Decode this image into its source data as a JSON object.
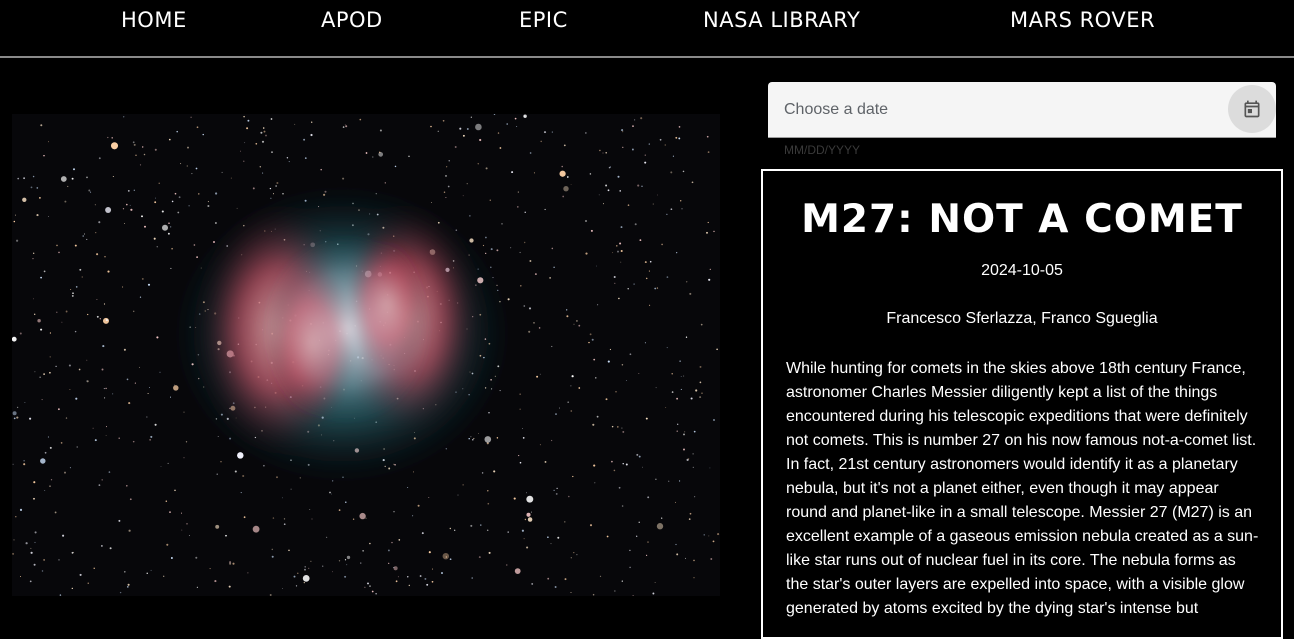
{
  "nav": {
    "items": [
      {
        "label": "HOME"
      },
      {
        "label": "APOD"
      },
      {
        "label": "EPIC"
      },
      {
        "label": "NASA LIBRARY"
      },
      {
        "label": "MARS ROVER"
      }
    ]
  },
  "date_picker": {
    "label": "Choose a date",
    "hint": "MM/DD/YYYY",
    "icon": "calendar-icon"
  },
  "apod": {
    "title": "M27: NOT A COMET",
    "date": "2024-10-05",
    "copyright": "Francesco Sferlazza, Franco Sgueglia",
    "explanation": "While hunting for comets in the skies above 18th century France, astronomer Charles Messier diligently kept a list of the things encountered during his telescopic expeditions that were definitely not comets. This is number 27 on his now famous not-a-comet list. In fact, 21st century astronomers would identify it as a planetary nebula, but it's not a planet either, even though it may appear round and planet-like in a small telescope. Messier 27 (M27) is an excellent example of a gaseous emission nebula created as a sun-like star runs out of nuclear fuel in its core. The nebula forms as the star's outer layers are expelled into space, with a visible glow generated by atoms excited by the dying star's intense but"
  },
  "colors": {
    "background": "#000000",
    "text": "#ffffff",
    "nav_divider": "#8a8a8a",
    "date_field_bg": "#f5f5f5"
  }
}
